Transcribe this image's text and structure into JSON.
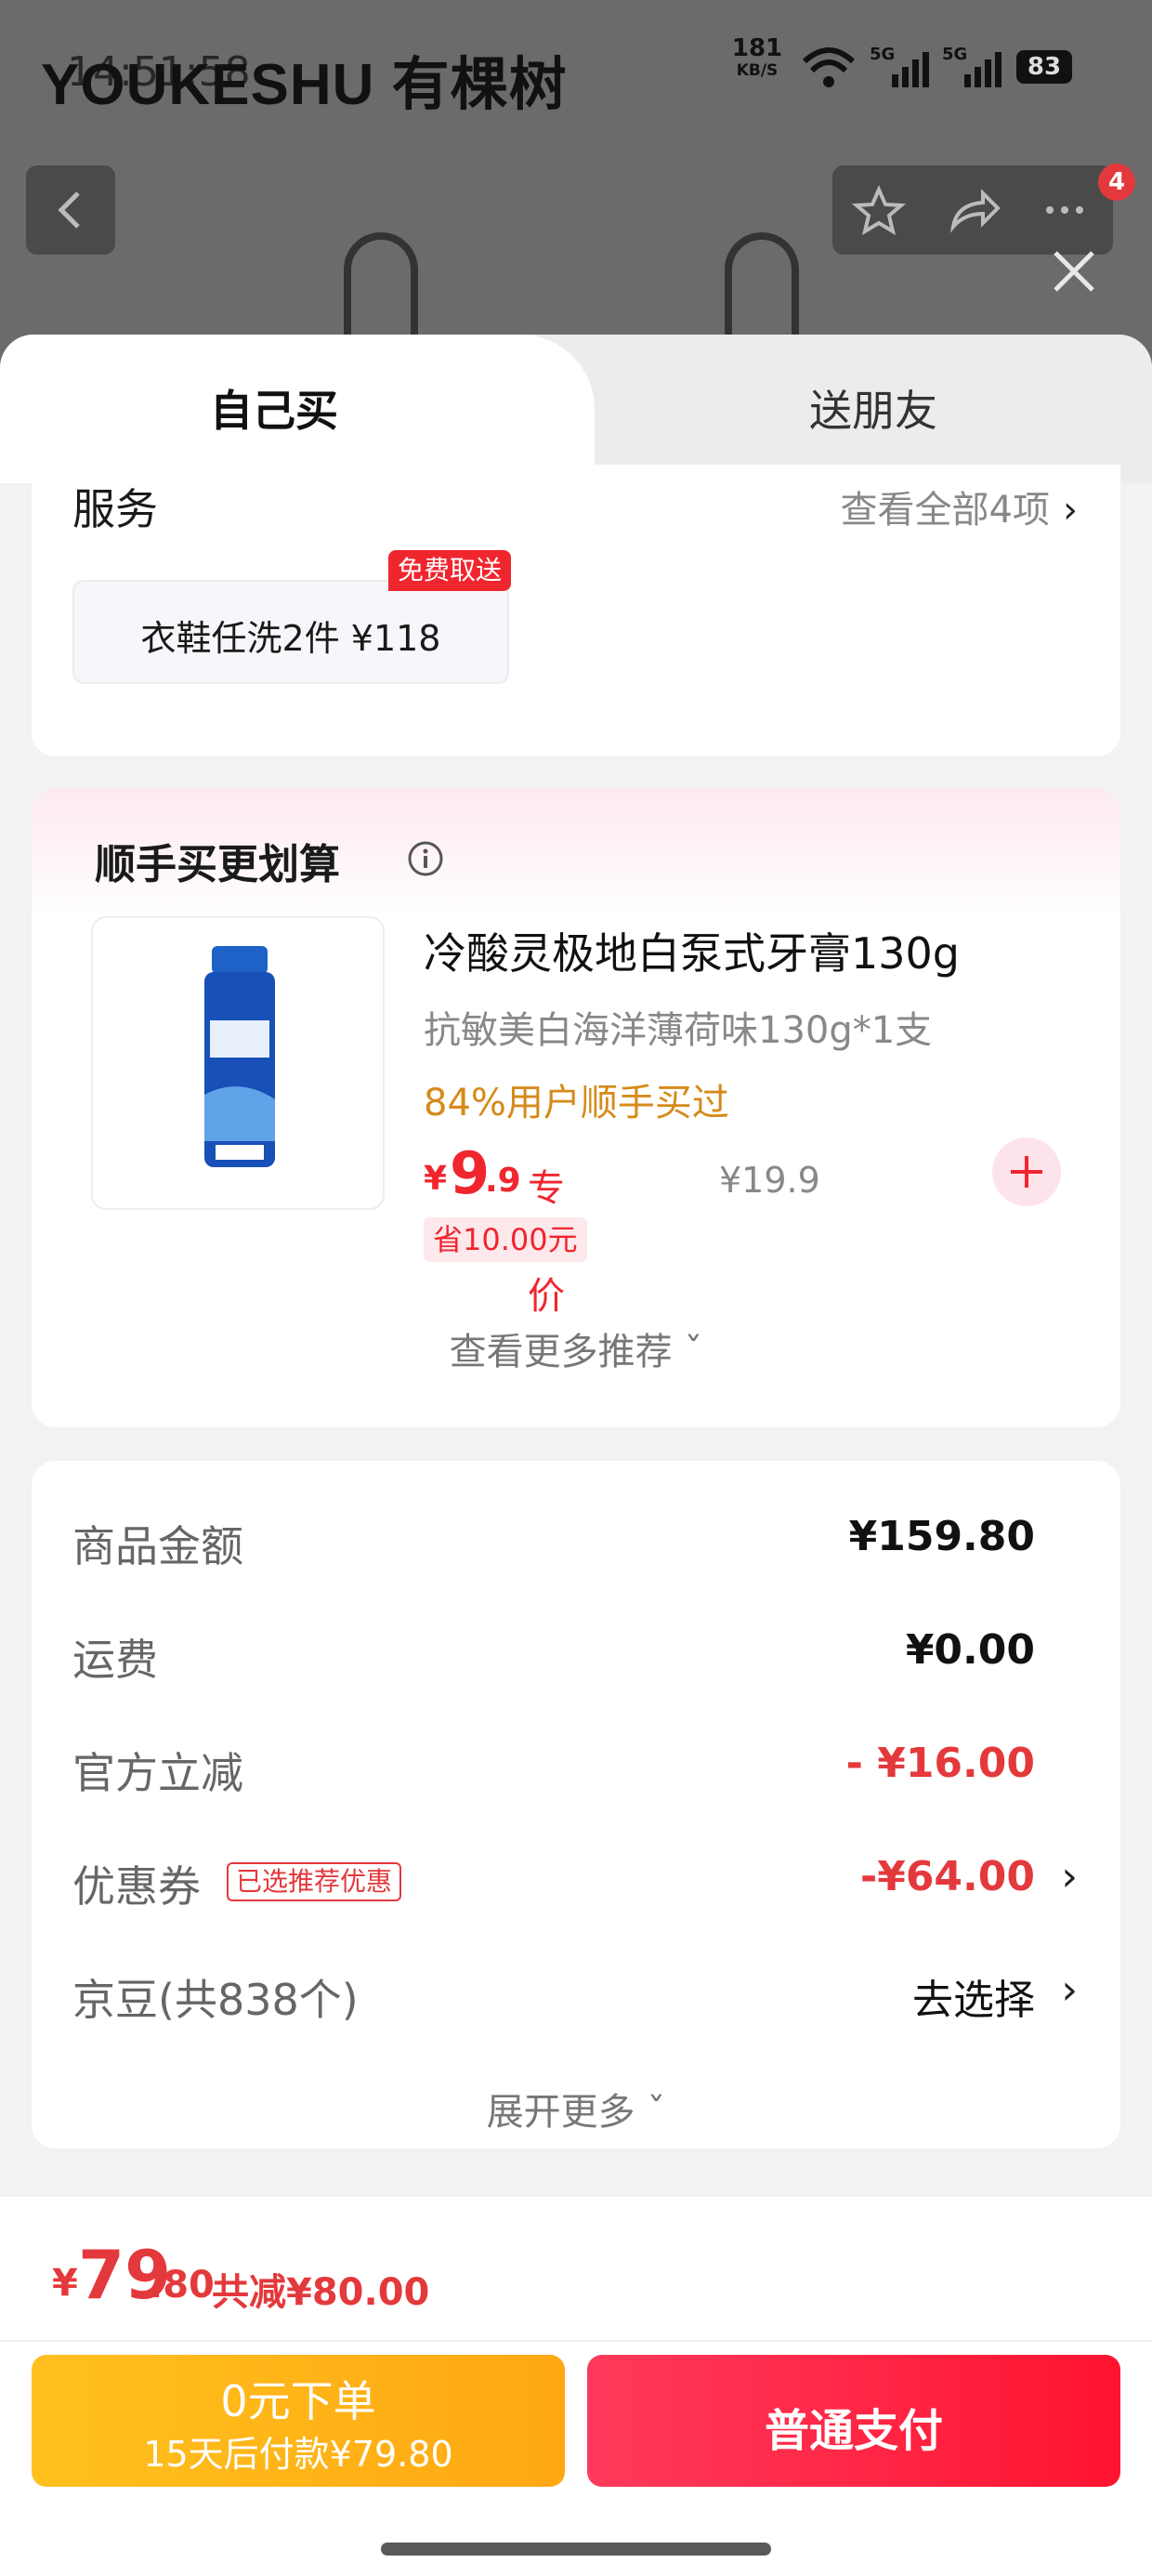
{
  "status_bar": {
    "brand": "YOUKESHU 有棵树",
    "clock": "14:51:58",
    "net_speed_value": "181",
    "net_speed_unit": "KB/S",
    "battery": "83"
  },
  "background_page": {
    "cart_badge": "4"
  },
  "tabs": {
    "self": "自己买",
    "friend": "送朋友"
  },
  "service": {
    "title": "服务",
    "view_all": "查看全部4项",
    "chevron": "›",
    "chip_label": "衣鞋任洗2件  ¥118",
    "chip_badge": "免费取送"
  },
  "addon": {
    "title": "顺手买更划算",
    "product_name": "冷酸灵极地白泵式牙膏130g",
    "product_sub": "抗敏美白海洋薄荷味130g*1支",
    "social_proof": "84%用户顺手买过",
    "price_symbol": "¥",
    "price_int": "9",
    "price_dec": ".9",
    "price_tag": "专享价",
    "original_price": "¥19.9",
    "save_tag": "省10.00元",
    "more_recommend": "查看更多推荐 ˇ"
  },
  "summary": {
    "rows": [
      {
        "label": "商品金额",
        "value": "¥159.80"
      },
      {
        "label": "运费",
        "value": "¥0.00"
      },
      {
        "label": "官方立减",
        "value": "- ¥16.00"
      },
      {
        "label": "优惠券",
        "badge": "已选推荐优惠",
        "value": "-¥64.00",
        "chevron": "›"
      },
      {
        "label": "京豆(共838个)",
        "value": "去选择",
        "chevron": "›"
      }
    ],
    "expand_more": "展开更多 ˇ"
  },
  "bottom": {
    "total_symbol": "¥",
    "total_int": "79",
    "total_dec": ".80",
    "total_saved": "共减¥80.00",
    "zero_pay_line1": "0元下单",
    "zero_pay_line2": "15天后付款¥79.80",
    "pay_button": "普通支付"
  },
  "colors": {
    "accent_red": "#e4393c",
    "pay_red": "#ff1430",
    "zero_pay_orange": "#ffa812",
    "social_orange": "#d68a1a"
  }
}
